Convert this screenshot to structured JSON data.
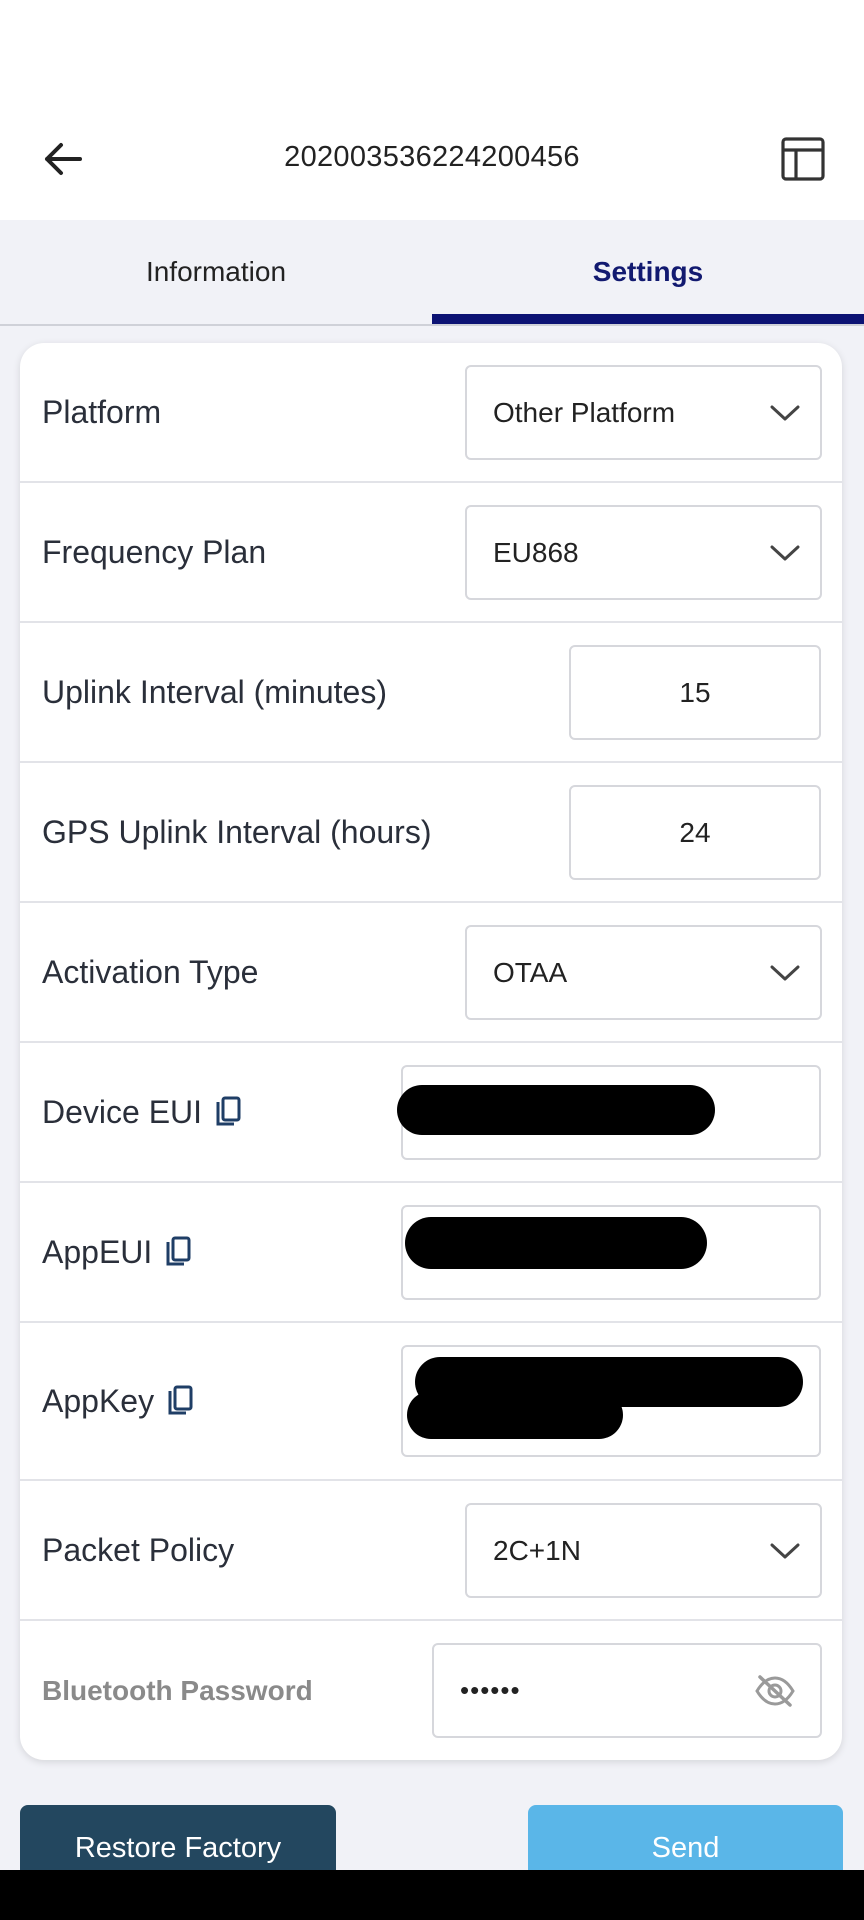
{
  "header": {
    "title": "202003536224200456",
    "back_icon": "arrow-left-icon",
    "layout_icon": "layout-icon"
  },
  "tabs": [
    {
      "label": "Information",
      "active": false
    },
    {
      "label": "Settings",
      "active": true
    }
  ],
  "settings": {
    "platform": {
      "label": "Platform",
      "value": "Other Platform"
    },
    "frequency_plan": {
      "label": "Frequency Plan",
      "value": "EU868"
    },
    "uplink_interval": {
      "label": "Uplink Interval (minutes)",
      "value": "15"
    },
    "gps_uplink_interval": {
      "label": "GPS Uplink Interval (hours)",
      "value": "24"
    },
    "activation_type": {
      "label": "Activation Type",
      "value": "OTAA"
    },
    "device_eui": {
      "label": "Device EUI"
    },
    "app_eui": {
      "label": "AppEUI"
    },
    "app_key": {
      "label": "AppKey"
    },
    "packet_policy": {
      "label": "Packet Policy",
      "value": "2C+1N"
    },
    "bluetooth_password": {
      "label": "Bluetooth Password",
      "value": "••••••"
    }
  },
  "actions": {
    "restore_label": "Restore Factory",
    "send_label": "Send"
  },
  "colors": {
    "accent": "#0c1374",
    "restore_button": "#23475f",
    "send_button": "#5ab6e8",
    "background": "#f1f2f7"
  }
}
